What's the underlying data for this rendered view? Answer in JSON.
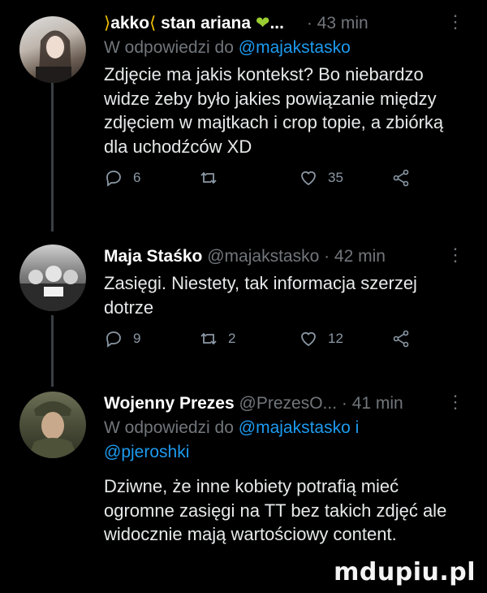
{
  "tweets": [
    {
      "author_name": "akko",
      "author_name_2": "stan ariana",
      "handle": "",
      "time": "· 43 min",
      "reply_prefix": "W odpowiedzi do ",
      "reply_to": "@majakstasko",
      "reply_to_2": "",
      "text": "Zdjęcie ma jakis kontekst? Bo niebardzo widze żeby było jakies powiązanie między zdjęciem w majtkach i crop topie, a zbiórką dla uchodźców XD",
      "replies": "6",
      "retweets": "",
      "likes": "35"
    },
    {
      "author_name": "Maja Staśko",
      "handle": "@majakstasko",
      "time": "· 42 min",
      "text": "Zasięgi. Niestety, tak informacja szerzej dotrze",
      "replies": "9",
      "retweets": "2",
      "likes": "12"
    },
    {
      "author_name": "Wojenny Prezes",
      "handle": "@PrezesO...",
      "time": "· 41 min",
      "reply_prefix": "W odpowiedzi do ",
      "reply_to": "@majakstasko i",
      "reply_to_2": "@pjeroshki",
      "text": "Dziwne, że inne kobiety potrafią mieć ogromne zasięgi na TT bez takich zdjęć ale widocznie mają wartościowy content."
    }
  ],
  "watermark": "mdupiu.pl",
  "icons": [
    "reply-icon",
    "retweet-icon",
    "like-icon",
    "share-icon",
    "more-icon"
  ]
}
